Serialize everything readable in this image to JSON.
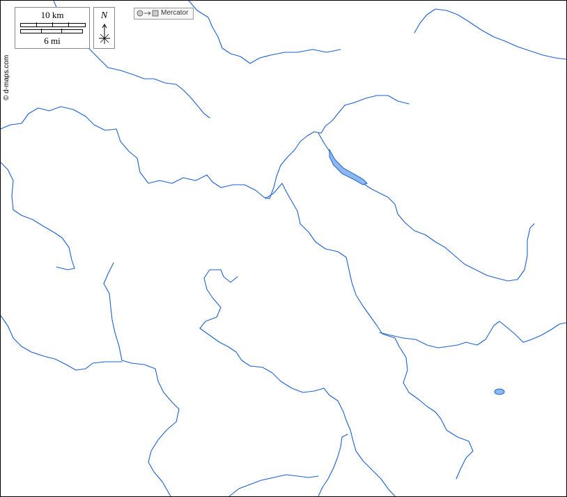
{
  "map": {
    "credit": "© d-maps.com",
    "scale": {
      "km_label": "10 km",
      "mi_label": "6 mi"
    },
    "north_label": "N",
    "projection": {
      "label": "Mercator",
      "icon": "circle-to-square-icon"
    },
    "colors": {
      "river": "#1a5fd0",
      "lake_fill": "#8cb8f0",
      "background": "#ffffff",
      "frame": "#000000"
    }
  }
}
